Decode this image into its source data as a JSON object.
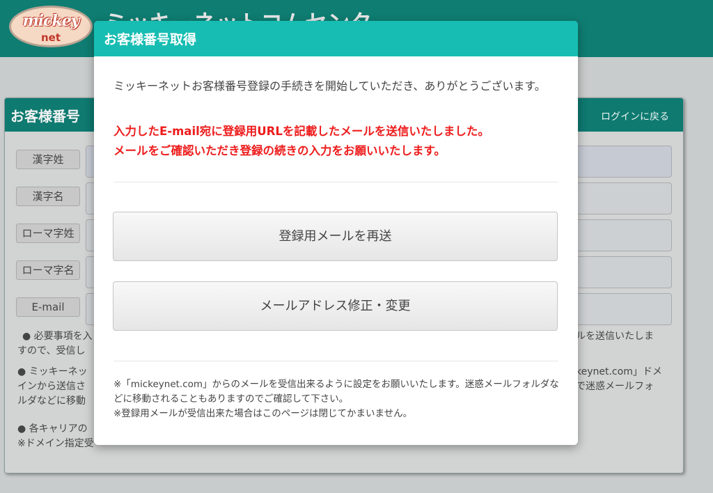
{
  "site": {
    "logo_top": "mickey",
    "logo_bottom": "net",
    "title": "ミッキーネットコムセンタ"
  },
  "panel": {
    "title": "お客様番号",
    "back_link": "ログインに戻る",
    "fields": [
      {
        "label": "漢字姓"
      },
      {
        "label": "漢字名"
      },
      {
        "label": "ローマ字姓"
      },
      {
        "label": "ローマ字名"
      },
      {
        "label": "E-mail"
      }
    ],
    "note_fragments": {
      "left_1a": "● 必要事項を入",
      "left_1b": "すので、受信し",
      "right_1": "ルを送信いたしま",
      "left_2a": "● ミッキーネッ",
      "left_2b": "インから送信さ",
      "left_2c": "ルダなどに移動",
      "right_2a": "keynet.com」ドメ",
      "right_2b": "で迷惑メールフォ",
      "left_3a": "● 各キャリアの",
      "left_3b": "※ドメイン指定受"
    }
  },
  "modal": {
    "title": "お客様番号取得",
    "intro": "ミッキーネットお客様番号登録の手続きを開始していただき、ありがとうございます。",
    "alert_line1": "入力したE-mail宛に登録用URLを記載したメールを送信いたしました。",
    "alert_line2": "メールをご確認いただき登録の続きの入力をお願いいたします。",
    "resend_button": "登録用メールを再送",
    "change_button": "メールアドレス修正・変更",
    "footnote_line1": "※「mickeynet.com」からのメールを受信出来るように設定をお願いいたします。迷惑メールフォルダなどに移動されることもありますのでご確認して下さい。",
    "footnote_line2": "※登録用メールが受信出来た場合はこのページは閉じてかまいません。"
  },
  "colors": {
    "header_teal": "#0f7d72",
    "modal_head": "#17bdb2",
    "alert_red": "#ee1c1c"
  }
}
